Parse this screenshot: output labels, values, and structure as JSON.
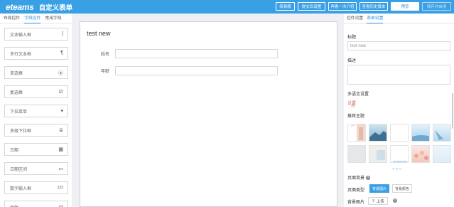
{
  "header": {
    "logo": "eteams",
    "title": "自定义表单",
    "buttons": [
      {
        "label": "简易版",
        "style": "outline"
      },
      {
        "label": "提交后设置",
        "style": "outline"
      },
      {
        "label": "再看一次介绍",
        "style": "outline"
      },
      {
        "label": "查看历史版本",
        "style": "outline"
      },
      {
        "label": "预览",
        "style": "white"
      },
      {
        "label": "保存并启用",
        "style": "disabled"
      }
    ]
  },
  "left_panel": {
    "tabs": [
      "布局控件",
      "字段控件",
      "常用字段"
    ],
    "active_tab": "字段控件",
    "components": [
      {
        "label": "文本输入框",
        "icon": "text-input-icon",
        "glyph": "|"
      },
      {
        "label": "多行文本框",
        "icon": "paragraph-icon",
        "glyph": "¶"
      },
      {
        "label": "单选框",
        "icon": "radio-icon",
        "glyph": "⦿"
      },
      {
        "label": "复选框",
        "icon": "checkbox-icon",
        "glyph": "☑"
      },
      {
        "label": "下拉菜单",
        "icon": "caret-down-icon",
        "glyph": "▾"
      },
      {
        "label": "多级下拉框",
        "icon": "cascade-icon",
        "glyph": "⇊"
      },
      {
        "label": "日期",
        "icon": "calendar-icon",
        "glyph": "▦"
      },
      {
        "label": "日期区间",
        "icon": "calendar-range-icon",
        "glyph": "▭"
      },
      {
        "label": "数字输入框",
        "icon": "number-icon",
        "glyph": "123"
      },
      {
        "label": "金额",
        "icon": "money-icon",
        "glyph": "⛁"
      }
    ]
  },
  "canvas": {
    "form_title": "test new",
    "fields": [
      {
        "label": "姓名",
        "value": ""
      },
      {
        "label": "年龄",
        "value": ""
      }
    ]
  },
  "right_panel": {
    "tabs": [
      "控件设置",
      "表单设置"
    ],
    "active_tab": "表单设置",
    "title_label": "标题",
    "title_value": "test new",
    "desc_label": "描述",
    "desc_value": "",
    "multilang_label": "多语言设置",
    "multilang_link": "设置",
    "theme_label": "推荐主题",
    "pager": "○○○",
    "bg_label": "页面背景",
    "bg_type_label": "页面类型",
    "bg_type_options": [
      "背景图片",
      "背景颜色"
    ],
    "bg_type_selected": "背景图片",
    "bg_image_label": "背景图片",
    "upload_label": "上传",
    "help_glyph": "?"
  },
  "colors": {
    "brand": "#3aa0e6",
    "link": "#e26a5c"
  }
}
